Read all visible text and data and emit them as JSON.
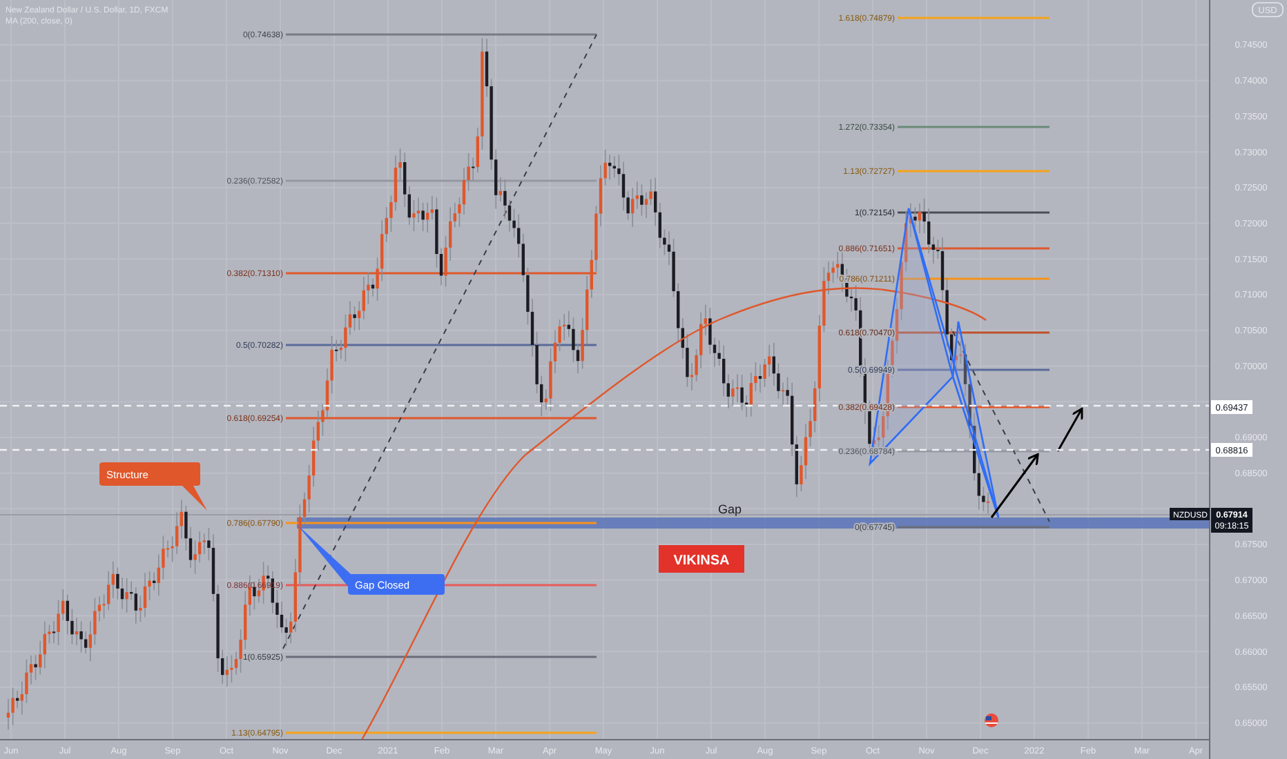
{
  "legend": {
    "symbol_title": "New Zealand Dollar / U.S. Dollar, 1D, FXCM",
    "indicator": "MA (200, close, 0)"
  },
  "price_axis": {
    "currency_button": "USD",
    "ticks": [
      "0.74500",
      "0.74000",
      "0.73500",
      "0.73000",
      "0.72500",
      "0.72000",
      "0.71500",
      "0.71000",
      "0.70500",
      "0.70000",
      "0.69000",
      "0.68500",
      "0.67500",
      "0.67000",
      "0.66500",
      "0.66000",
      "0.65500",
      "0.65000"
    ],
    "markers": [
      {
        "kind": "line",
        "value": "0.69437"
      },
      {
        "kind": "line",
        "value": "0.68816"
      },
      {
        "kind": "last",
        "symbol": "NZDUSD",
        "value": "0.67914",
        "countdown": "09:18:15"
      }
    ]
  },
  "time_axis": {
    "ticks": [
      "Jun",
      "Jul",
      "Aug",
      "Sep",
      "Oct",
      "Nov",
      "Dec",
      "2021",
      "Feb",
      "Mar",
      "Apr",
      "May",
      "Jun",
      "Jul",
      "Aug",
      "Sep",
      "Oct",
      "Nov",
      "Dec",
      "2022",
      "Feb",
      "Mar",
      "Apr"
    ]
  },
  "fib_levels_left": [
    {
      "label": "0(0.74638)",
      "color": "#787b86"
    },
    {
      "label": "0.236(0.72582)",
      "color": "#9598a1"
    },
    {
      "label": "0.382(0.71310)",
      "color": "#e0572b"
    },
    {
      "label": "0.5(0.70282)",
      "color": "#5b6b9a"
    },
    {
      "label": "0.618(0.69254)",
      "color": "#e0572b"
    },
    {
      "label": "0.786(0.67790)",
      "color": "#f7931a"
    },
    {
      "label": "0.886(0.66919)",
      "color": "#e85a5a"
    },
    {
      "label": "1(0.65925)",
      "color": "#6a6d78"
    },
    {
      "label": "1.13(0.64795)",
      "color": "#f7a21a"
    }
  ],
  "fib_levels_right": [
    {
      "label": "1.618(0.74879)",
      "color": "#f7a21a"
    },
    {
      "label": "1.272(0.73354)",
      "color": "#6a8a78"
    },
    {
      "label": "1.13(0.72727)",
      "color": "#f7a21a"
    },
    {
      "label": "1(0.72154)",
      "color": "#4a4d58"
    },
    {
      "label": "0.886(0.71651)",
      "color": "#e0572b"
    },
    {
      "label": "0.786(0.71211)",
      "color": "#f7931a"
    },
    {
      "label": "0.618(0.70470)",
      "color": "#c0502b"
    },
    {
      "label": "0.5(0.69949)",
      "color": "#5b6b9a"
    },
    {
      "label": "0.382(0.69428)",
      "color": "#e0572b"
    },
    {
      "label": "0.236(0.68784)",
      "color": "#9598a1"
    },
    {
      "label": "0(0.67745)",
      "color": "#6a6d78"
    }
  ],
  "annotations": [
    {
      "kind": "callout",
      "text": "Structure",
      "color": "#e0572b"
    },
    {
      "kind": "callout",
      "text": "Gap Closed",
      "color": "#3d6ef2"
    },
    {
      "kind": "text",
      "text": "Gap"
    },
    {
      "kind": "badge",
      "text": "VIKINSA"
    }
  ]
}
